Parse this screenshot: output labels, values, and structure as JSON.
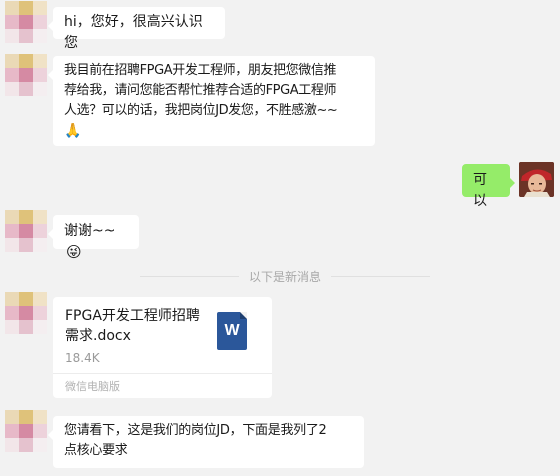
{
  "messages": [
    {
      "sender": "contact",
      "text": "hi，您好，很高兴认识您"
    },
    {
      "sender": "contact",
      "text_lines": [
        "我目前在招聘FPGA开发工程师，朋友把您微信推",
        "荐给我，请问您能否帮忙推荐合适的FPGA工程师",
        "人选？可以的话，我把岗位JD发您，不胜感激~~"
      ],
      "trailing_emoji": "🙏"
    },
    {
      "sender": "me",
      "text": "可以"
    },
    {
      "sender": "contact",
      "text": "谢谢~~",
      "trailing_emoji": "😜"
    },
    {
      "sender": "contact",
      "text_lines": [
        "您请看下，这是我们的岗位JD，下面是我列了2",
        "点核心要求"
      ]
    }
  ],
  "divider_text": "以下是新消息",
  "file": {
    "name_lines": [
      "FPGA开发工程师招聘",
      "需求.docx"
    ],
    "size": "18.4K",
    "source": "微信电脑版",
    "icon": "word-doc-icon",
    "icon_letter": "W"
  },
  "colors": {
    "background": "#f2f2f2",
    "incoming_bubble": "#ffffff",
    "outgoing_bubble": "#95ec69",
    "word_blue": "#2b579a"
  }
}
